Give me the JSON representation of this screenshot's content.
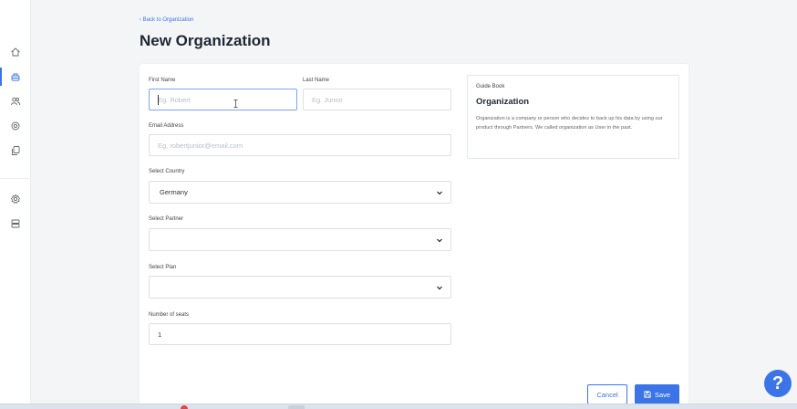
{
  "nav": {
    "back_link": "‹ Back to Organization",
    "page_title": "New Organization"
  },
  "sidebar": {
    "items": [
      {
        "icon": "home-icon",
        "active": false
      },
      {
        "icon": "organization-icon",
        "active": true
      },
      {
        "icon": "users-icon",
        "active": false
      },
      {
        "icon": "partners-icon",
        "active": false
      },
      {
        "icon": "copy-icon",
        "active": false
      },
      {
        "icon": "gear-icon",
        "active": false
      },
      {
        "icon": "server-icon",
        "active": false
      }
    ]
  },
  "form": {
    "first_name": {
      "label": "First Name",
      "placeholder": "Eg. Robert",
      "value": ""
    },
    "last_name": {
      "label": "Last Name",
      "placeholder": "Eg. Junior",
      "value": ""
    },
    "email": {
      "label": "Email Address",
      "placeholder": "Eg. robertjunior@email.com",
      "value": ""
    },
    "country": {
      "label": "Select Country",
      "value": "Germany"
    },
    "partner": {
      "label": "Select Partner",
      "value": ""
    },
    "plan": {
      "label": "Select Plan",
      "value": ""
    },
    "seats": {
      "label": "Number of seats",
      "value": "1"
    }
  },
  "guide": {
    "caption": "Guide Book",
    "title": "Organization",
    "text": "Organization is a company or person who decides to back up his data by using our product through Partners. We called organization as User in the past."
  },
  "actions": {
    "cancel_label": "Cancel",
    "save_label": "Save"
  },
  "help": {
    "label": "?"
  },
  "colors": {
    "accent": "#3a74e6",
    "background": "#f4f5f7",
    "card": "#ffffff"
  }
}
